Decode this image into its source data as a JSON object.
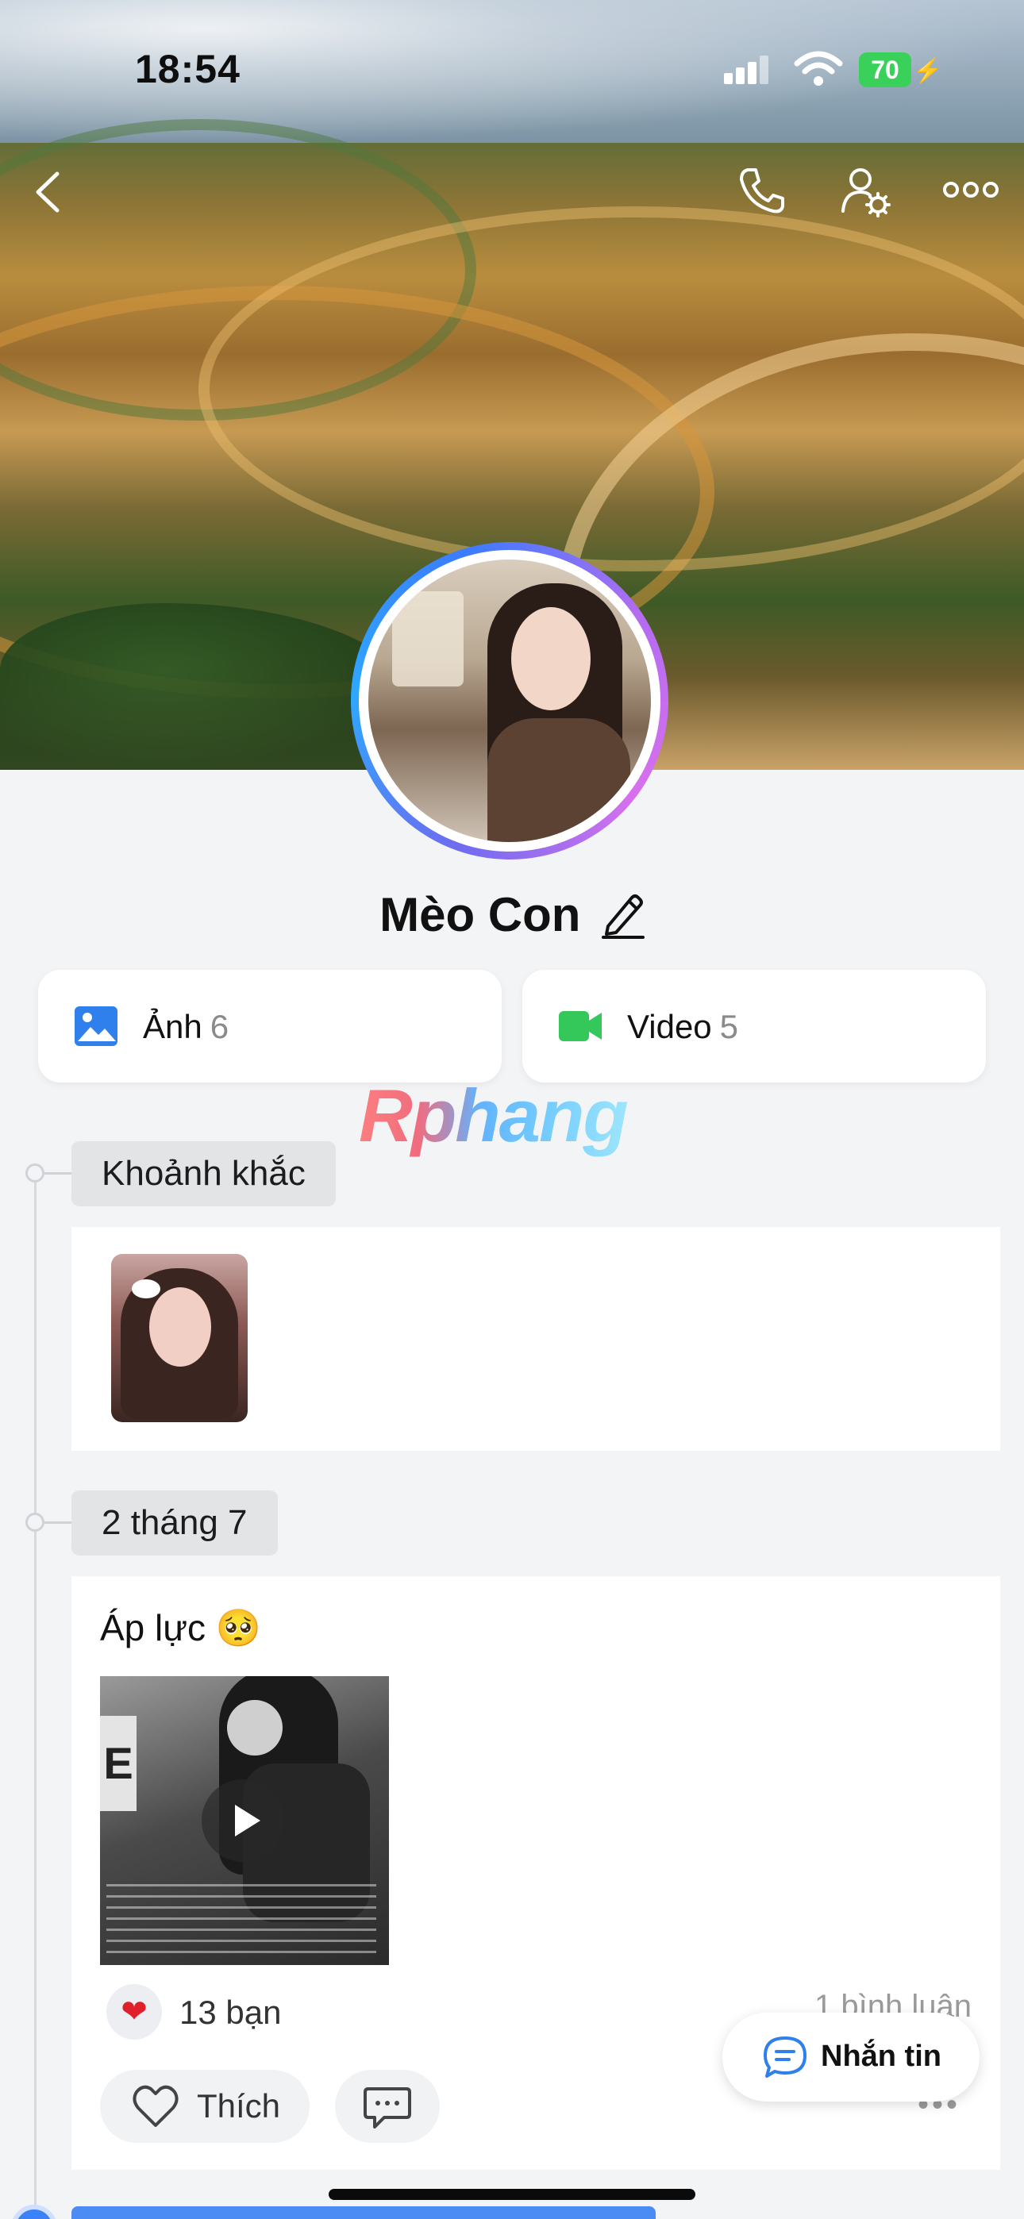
{
  "status_bar": {
    "time": "18:54",
    "battery": "70"
  },
  "nav": {
    "back_icon": "chevron-left-icon",
    "call_icon": "phone-icon",
    "settings_icon": "user-gear-icon",
    "more_icon": "more-dots-icon"
  },
  "profile": {
    "name": "Mèo Con"
  },
  "media": {
    "photo_label": "Ảnh",
    "photo_count": "6",
    "video_label": "Video",
    "video_count": "5"
  },
  "watermark": "Rphang",
  "timeline": {
    "moments_label": "Khoảnh khắc",
    "date_label": "2 tháng 7"
  },
  "post": {
    "text": "Áp lực 🥺",
    "media_letters": "E",
    "reaction_count": "13 bạn",
    "comment_count": "1 bình luận",
    "like_label": "Thích"
  },
  "fab": {
    "label": "Nhắn tin"
  },
  "colors": {
    "accent": "#2f80ed",
    "video_green": "#34c759",
    "battery_green": "#3ad15b",
    "heart_red": "#e0202a"
  }
}
